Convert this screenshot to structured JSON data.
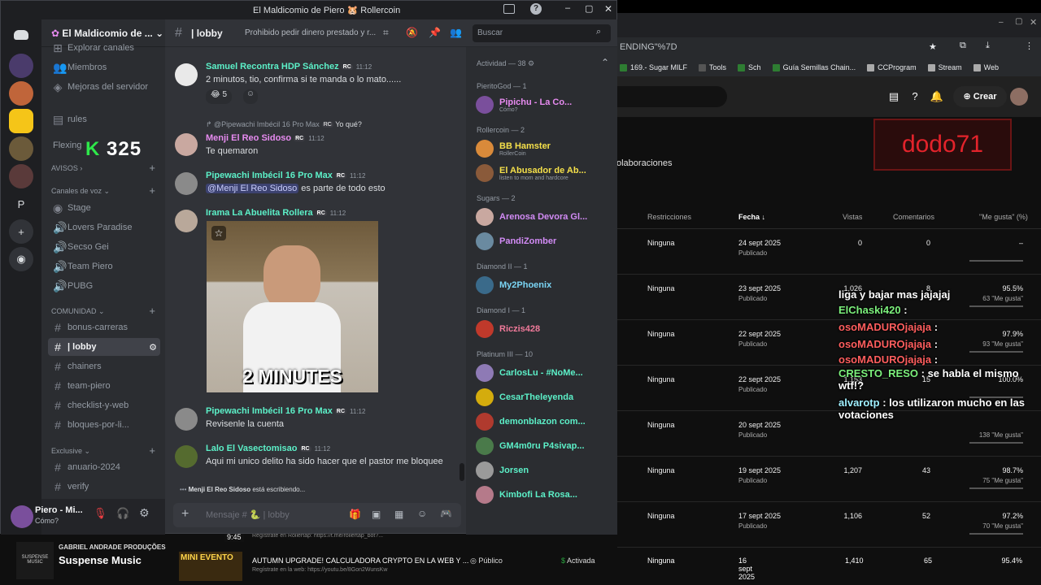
{
  "window": {
    "title": "El Maldicomio de Piero 🐹 Rollercoin"
  },
  "youtube": {
    "address": "ENDING\"%7D",
    "bookmarks": [
      "169.- Sugar MILF",
      "Tools",
      "Sch",
      "Guía Semillas Chain...",
      "CCProgram",
      "Stream",
      "Web"
    ],
    "create": "Crear",
    "banner": "dodo71",
    "collab": "olaboraciones",
    "headers": {
      "restrictions": "Restricciones",
      "date": "Fecha",
      "views": "Vistas",
      "comments": "Comentarios",
      "likes": "\"Me gusta\" (%)"
    },
    "rows": [
      {
        "restr": "Ninguna",
        "date": "24 sept 2025",
        "status": "Publicado",
        "views": "0",
        "comments": "0",
        "pct": "–",
        "likes": ""
      },
      {
        "restr": "Ninguna",
        "date": "23 sept 2025",
        "status": "Publicado",
        "views": "1,026",
        "comments": "8",
        "pct": "95.5%",
        "likes": "63 \"Me gusta\""
      },
      {
        "restr": "Ninguna",
        "date": "22 sept 2025",
        "status": "Publicado",
        "views": "",
        "comments": "",
        "pct": "97.9%",
        "likes": "93 \"Me gusta\""
      },
      {
        "restr": "Ninguna",
        "date": "22 sept 2025",
        "status": "Publicado",
        "views": "1,153",
        "comments": "15",
        "pct": "100.0%",
        "likes": ""
      },
      {
        "restr": "Ninguna",
        "date": "20 sept 2025",
        "status": "Publicado",
        "views": "",
        "comments": "",
        "pct": "",
        "likes": "138 \"Me gusta\""
      },
      {
        "restr": "Ninguna",
        "date": "19 sept 2025",
        "status": "Publicado",
        "views": "1,207",
        "comments": "43",
        "pct": "98.7%",
        "likes": "75 \"Me gusta\""
      },
      {
        "restr": "Ninguna",
        "date": "17 sept 2025",
        "status": "Publicado",
        "views": "1,106",
        "comments": "52",
        "pct": "97.2%",
        "likes": "70 \"Me gusta\""
      },
      {
        "restr": "Ninguna",
        "date": "16 sept 2025",
        "status": "Publicado",
        "views": "1,410",
        "comments": "65",
        "pct": "95.4%",
        "likes": ""
      }
    ],
    "chat": [
      {
        "name": "",
        "text": "liga y bajar mas jajajaj"
      },
      {
        "name": "ElChaski420",
        "text": ":"
      },
      {
        "name": "osoMADUROjajaja",
        "text": ":"
      },
      {
        "name": "osoMADUROjajaja",
        "text": ":"
      },
      {
        "name": "osoMADUROjajaja",
        "text": ":"
      },
      {
        "name": "CRESTO_RESO",
        "text": ": se habla el mismo wtf!?"
      },
      {
        "name": "alvarotp",
        "text": ": los utilizaron mucho en las votaciones"
      }
    ]
  },
  "server": {
    "name": "El Maldicomio de ...",
    "overlay_value": "325"
  },
  "channels": {
    "top": [
      {
        "label": "Explorar canales"
      },
      {
        "label": "Miembros"
      },
      {
        "label": "Mejoras del servidor"
      }
    ],
    "misc": [
      {
        "label": "rules"
      },
      {
        "label": "Flexing"
      }
    ],
    "cat_avisos": "AVISOS",
    "cat_voz": "Canales de voz",
    "voice": [
      {
        "label": "Stage"
      },
      {
        "label": "Lovers Paradise"
      },
      {
        "label": "Secso Gei"
      },
      {
        "label": "Team Piero"
      },
      {
        "label": "PUBG"
      }
    ],
    "cat_comunidad": "COMUNIDAD",
    "text": [
      {
        "label": "bonus-carreras"
      },
      {
        "label": "| lobby"
      },
      {
        "label": "chainers"
      },
      {
        "label": "team-piero"
      },
      {
        "label": "checklist-y-web"
      },
      {
        "label": "bloques-por-li..."
      }
    ],
    "cat_exclusive": "Exclusive",
    "exclusive": [
      {
        "label": "anuario-2024"
      },
      {
        "label": "verify"
      }
    ]
  },
  "user": {
    "name": "Piero - Mi...",
    "status": "Cómo?"
  },
  "topbar": {
    "channel": "| lobby",
    "topic": "Prohibido pedir dinero prestado y r...",
    "search_placeholder": "Buscar"
  },
  "messages": [
    {
      "author": "Samuel Recontra HDP Sánchez",
      "badge": "RC",
      "time": "11:12",
      "text": "2 minutos, tio, confirma si te manda o lo mato......",
      "reactions": "5"
    },
    {
      "author": "Menji El Reo Sidoso",
      "badge": "RC",
      "time": "11:12",
      "reply": "@Pipewachi Imbécil 16 Pro Max",
      "reply_badge": "RC",
      "reply_text": "Yo qué?",
      "text": "Te quemaron"
    },
    {
      "author": "Pipewachi Imbécil 16 Pro Max",
      "badge": "RC",
      "time": "11:12",
      "mention": "@Menji El Reo Sidoso",
      "text": "es parte de todo esto"
    },
    {
      "author": "Irama La Abuelita Rollera",
      "badge": "RC",
      "time": "11:12",
      "gif_caption": "2 MINUTES"
    },
    {
      "author": "Pipewachi Imbécil 16 Pro Max",
      "badge": "RC",
      "time": "11:12",
      "text": "Revisenle la cuenta"
    },
    {
      "author": "Lalo El Vasectomisao",
      "badge": "RC",
      "time": "11:12",
      "text": "Aqui mi unico delito ha sido hacer que el pastor me bloquee"
    }
  ],
  "typing": {
    "who": "Menji El Reo Sidoso",
    "suffix": "está escribiendo..."
  },
  "composer": {
    "placeholder": "Mensaje # 🐍 | lobby"
  },
  "members": {
    "header": "Actividad — 38",
    "groups": [
      {
        "title": "PieritoGod — 1",
        "items": [
          {
            "name": "Pipichu - La Co...",
            "status": "Cómo?",
            "color": "#e78bf0"
          }
        ]
      },
      {
        "title": "Rollercoin — 2",
        "items": [
          {
            "name": "BB Hamster",
            "status": "RollerCoin",
            "color": "#f5e04a"
          },
          {
            "name": "El Abusador de Ab...",
            "status": "listen to mom and hardcore",
            "color": "#f5e04a"
          }
        ]
      },
      {
        "title": "Sugars — 2",
        "items": [
          {
            "name": "Arenosa Devora Gl...",
            "status": "",
            "color": "#d28bf5"
          },
          {
            "name": "PandiZomber",
            "status": "",
            "color": "#d28bf5"
          }
        ]
      },
      {
        "title": "Diamond II — 1",
        "items": [
          {
            "name": "My2Phoenix",
            "status": "",
            "color": "#7ad5f5"
          }
        ]
      },
      {
        "title": "Diamond I — 1",
        "items": [
          {
            "name": "Riczis428",
            "status": "",
            "color": "#f07a9a"
          }
        ]
      },
      {
        "title": "Platinum III — 10",
        "items": [
          {
            "name": "CarlosLu - #NoMe...",
            "status": "",
            "color": "#5cf0c8"
          },
          {
            "name": "CesarTheleyenda",
            "status": "",
            "color": "#5cf0c8"
          },
          {
            "name": "demonblazon com...",
            "status": "",
            "color": "#5cf0c8"
          },
          {
            "name": "GM4m0ru P4sivap...",
            "status": "",
            "color": "#5cf0c8"
          },
          {
            "name": "Jorsen",
            "status": "",
            "color": "#5cf0c8"
          },
          {
            "name": "Kimbofi La Rosa...",
            "status": "",
            "color": "#5cf0c8"
          }
        ]
      }
    ]
  },
  "stream": {
    "label1": "GABRIEL ANDRADE PRODUÇÕES",
    "label2": "Suspense Music",
    "label_small": "SUSPENSE MUSIC",
    "row_line": "Regístrate en Rollertap: https://t.me/rollertap_bot?...",
    "event": "MINI EVENTO",
    "time_badge": "9:45",
    "video_title": "AUTUMN UPGRADE! CALCULADORA CRYPTO EN LA WEB Y ...",
    "video_sub": "Regístrate en la web: https://youtu.be/8Gon2WunsKw",
    "visibility": "Público",
    "monet": "Activada",
    "restr": "Ninguna",
    "date": "16 sept 2025",
    "views": "1,410",
    "comments": "65",
    "pct": "95.4%"
  }
}
